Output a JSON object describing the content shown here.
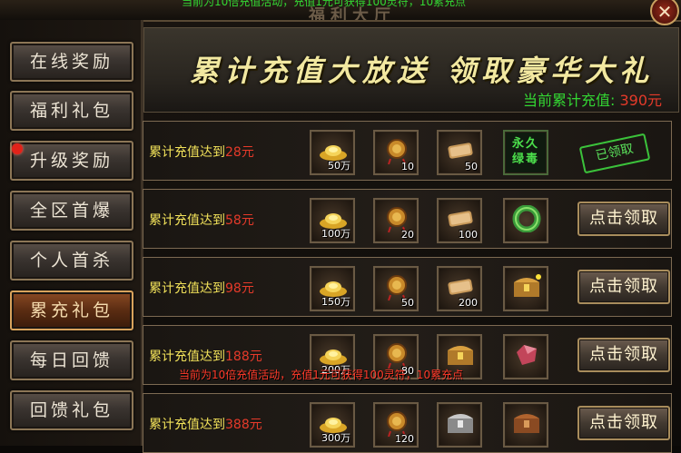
{
  "window": {
    "title": "福利大厅",
    "ticker_text": "当前为10倍充值活动，充值1元可获得100灵符，10累充点",
    "close_label": "✕"
  },
  "sidebar": {
    "items": [
      {
        "label": "在线奖励"
      },
      {
        "label": "福利礼包"
      },
      {
        "label": "升级奖励"
      },
      {
        "label": "全区首爆"
      },
      {
        "label": "个人首杀"
      },
      {
        "label": "累充礼包"
      },
      {
        "label": "每日回馈"
      },
      {
        "label": "回馈礼包"
      }
    ],
    "active_index": 5
  },
  "banner": {
    "title": "累计充值大放送 领取豪华大礼",
    "total_label": "当前累计充值:",
    "total_value": "390元"
  },
  "rows": [
    {
      "prefix": "累计充值达到",
      "amount": "28元",
      "items": [
        {
          "icon": "gold-ingot-icon",
          "count": "50万"
        },
        {
          "icon": "talisman-icon",
          "count": "10"
        },
        {
          "icon": "scroll-icon",
          "count": "50"
        },
        {
          "icon": "poison-skill-icon",
          "text": "永久绿毒",
          "count": ""
        }
      ],
      "status": "已领取",
      "claimed": true
    },
    {
      "prefix": "累计充值达到",
      "amount": "58元",
      "items": [
        {
          "icon": "gold-ingot-icon",
          "count": "100万"
        },
        {
          "icon": "talisman-icon",
          "count": "20"
        },
        {
          "icon": "scroll-icon",
          "count": "100"
        },
        {
          "icon": "jade-ring-icon",
          "count": ""
        }
      ],
      "status": "点击领取",
      "claimed": false
    },
    {
      "prefix": "累计充值达到",
      "amount": "98元",
      "items": [
        {
          "icon": "gold-ingot-icon",
          "count": "150万"
        },
        {
          "icon": "talisman-icon",
          "count": "50"
        },
        {
          "icon": "scroll-icon",
          "count": "200"
        },
        {
          "icon": "golden-chest-icon",
          "count": ""
        }
      ],
      "status": "点击领取",
      "claimed": false
    },
    {
      "prefix": "累计充值达到",
      "amount": "188元",
      "items": [
        {
          "icon": "gold-ingot-icon",
          "count": "200万"
        },
        {
          "icon": "talisman-icon",
          "count": "80"
        },
        {
          "icon": "golden-chest-icon",
          "count": ""
        },
        {
          "icon": "red-gem-icon",
          "count": ""
        }
      ],
      "status": "点击领取",
      "claimed": false
    },
    {
      "prefix": "累计充值达到",
      "amount": "388元",
      "items": [
        {
          "icon": "gold-ingot-icon",
          "count": "300万"
        },
        {
          "icon": "talisman-icon",
          "count": "120"
        },
        {
          "icon": "silver-chest-icon",
          "count": ""
        },
        {
          "icon": "bronze-chest-icon",
          "count": ""
        }
      ],
      "status": "点击领取",
      "claimed": false
    }
  ],
  "overlay_notice": "当前为10倍充值活动，充值1元可获得100灵符，10累充点",
  "colors": {
    "green": "#33d633",
    "red": "#e63a2a",
    "gold_text": "#f2e25a",
    "accent_active": "#8a4a24"
  }
}
